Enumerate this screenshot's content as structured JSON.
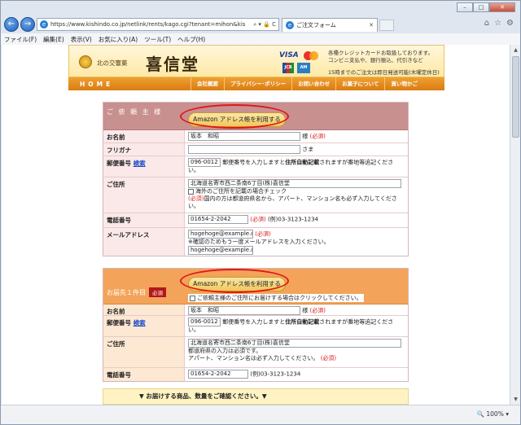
{
  "browser": {
    "url": "https://www.kishindo.co.jp/netlink/rents/kago.cgi?tenant=mihon&kis",
    "addr_tools": "⌕ ▾ 🔒 C",
    "tab_title": "ご注文フォーム",
    "menu": [
      "ファイル(F)",
      "編集(E)",
      "表示(V)",
      "お気に入り(A)",
      "ツール(T)",
      "ヘルプ(H)"
    ],
    "zoom": "100%"
  },
  "site": {
    "brand_small": "北の交響菓",
    "brand_big": "喜信堂",
    "card_note_1": "各種クレジットカードお取扱しております。",
    "card_note_2": "コンビニ支払や、銀行振込、代引きなど",
    "card_note_3": "15時までのご注文は即日発送可能(木曜定休日)",
    "nav_home": "HOME",
    "nav": [
      "会社概要",
      "プライバシー･ポリシー",
      "お問い合わせ",
      "お菓子について",
      "買い物かご"
    ]
  },
  "requester": {
    "title": "ご 依 頼 主 様",
    "amazon_btn": "Amazon アドレス帳を利用する",
    "name_label": "お名前",
    "name_value": "坂本　和昭",
    "name_suffix": "様",
    "required": "(必須)",
    "kana_label": "フリガナ",
    "kana_suffix": "さま",
    "zip_label": "郵便番号",
    "zip_search": "検索",
    "zip_value": "096-0012",
    "zip_note_1": "郵便番号を入力しますと",
    "zip_note_bold": "住所自動記載",
    "zip_note_2": "されますが番地等追記ください。",
    "addr_label": "ご住所",
    "addr_value": "北海道名寄市西二条南6丁目(株)喜信堂",
    "addr_check": "海外のご住所を記載の場合チェック",
    "addr_note": "国内の方は都道府県名から、アパート、マンション名も必ず入力してください。",
    "tel_label": "電話番号",
    "tel_value": "01654-2-2042",
    "tel_example": "(例)03-3123-1234",
    "mail_label": "メールアドレス",
    "mail_value": "hogehoge@example.com",
    "mail_note": "※確認のためもう一度メールアドレスを入力ください。",
    "mail_confirm": "hogehoge@example.com"
  },
  "delivery": {
    "title": "お届先１件目",
    "badge": "必須",
    "amazon_btn": "Amazon アドレス帳を利用する",
    "same_check": "ご依頼主様のご住所にお届けする場合はクリックしてください。",
    "name_label": "お名前",
    "name_value": "坂本　和昭",
    "name_suffix": "様",
    "required": "(必須)",
    "zip_label": "郵便番号",
    "zip_search": "検索",
    "zip_value": "096-0012",
    "zip_note_1": "郵便番号を入力しますと",
    "zip_note_bold": "住所自動記載",
    "zip_note_2": "されますが番地等追記ください。",
    "addr_label": "ご住所",
    "addr_value": "北海道名寄市西二条南6丁目(株)喜信堂",
    "addr_note_1": "都道府県の入力は必須です。",
    "addr_note_2": "アパート、マンション名は必ず入力してください。",
    "tel_label": "電話番号",
    "tel_value": "01654-2-2042",
    "tel_example": "(例)03-3123-1234"
  },
  "goods_bar": "▼ お届けする商品、数量をご確認ください。▼"
}
